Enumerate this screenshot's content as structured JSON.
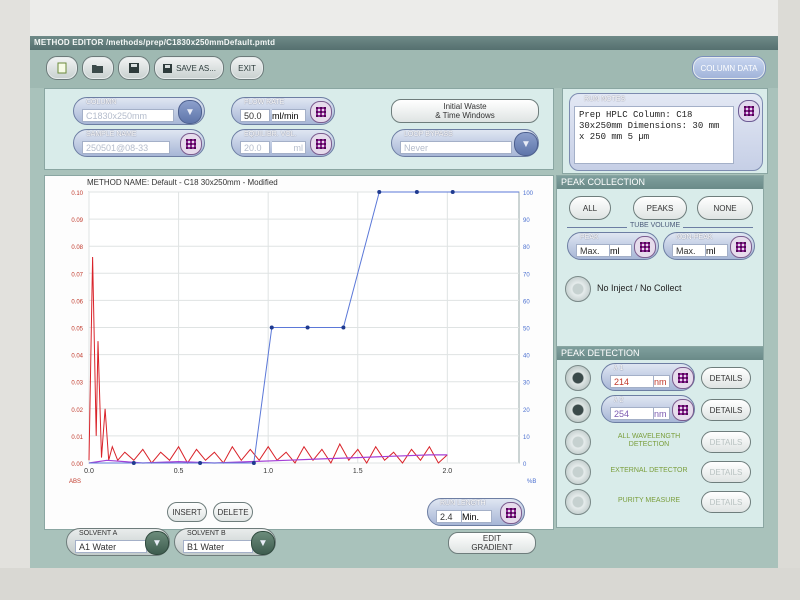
{
  "window": {
    "title": "METHOD EDITOR /methods/prep/C1830x250mmDefault.pmtd"
  },
  "toolbar": {
    "new_icon": "new-file-icon",
    "open_icon": "open-folder-icon",
    "save_icon": "save-disk-icon",
    "save_as_label": "SAVE AS...",
    "exit_label": "EXIT",
    "column_data_label": "COLUMN DATA"
  },
  "method": {
    "column": {
      "label": "COLUMN",
      "value": "C1830x250mm"
    },
    "sample_name": {
      "label": "SAMPLE NAME",
      "value": "250501@08-33"
    },
    "flow_rate": {
      "label": "FLOW RATE",
      "value": "50.0",
      "unit": "ml/min"
    },
    "equilibr_vol": {
      "label": "EQUILIBR. VOL.",
      "value": "20.0",
      "unit": "ml"
    },
    "initial_waste_label": "Initial Waste\n& Time Windows",
    "loop_bypass": {
      "label": "LOOP BYPASS",
      "value": "Never"
    }
  },
  "run_notes": {
    "label": "RUN NOTES",
    "text": "Prep HPLC Column: C18\n30x250mm Dimensions: 30 mm\nx 250 mm 5 µm"
  },
  "chart_title": "METHOD NAME: Default - C18 30x250mm - Modified",
  "chart_data": {
    "type": "line",
    "xlabel": "",
    "ylabel_left": "ABS",
    "ylabel_right": "%B",
    "xlim": [
      0,
      2.4
    ],
    "ylim_left": [
      0,
      0.1
    ],
    "ylim_right": [
      0,
      100
    ],
    "x_ticks": [
      "0.0",
      "0.5",
      "1.0",
      "1.5",
      "2.0"
    ],
    "y_ticks_left": [
      "0.00",
      "0.01",
      "0.02",
      "0.03",
      "0.04",
      "0.05",
      "0.06",
      "0.07",
      "0.08",
      "0.09",
      "0.10"
    ],
    "y_ticks_right": [
      "0",
      "10",
      "20",
      "30",
      "40",
      "50",
      "60",
      "70",
      "80",
      "90",
      "100"
    ],
    "gradient": {
      "x": [
        0.0,
        0.25,
        0.62,
        0.92,
        1.02,
        1.22,
        1.42,
        1.62,
        1.83,
        2.03,
        2.4
      ],
      "y": [
        0,
        0,
        0,
        0,
        50,
        50,
        50,
        100,
        100,
        100,
        100
      ]
    },
    "absorbance_red": {
      "x": [
        0.0,
        0.02,
        0.04,
        0.05,
        0.07,
        0.09,
        0.11,
        0.13,
        0.16,
        0.2,
        0.25,
        0.3,
        0.35,
        0.4,
        0.45,
        0.5,
        0.55,
        0.6,
        0.65,
        0.7,
        0.75,
        0.8,
        0.85,
        0.9,
        0.95,
        1.0,
        1.05,
        1.1,
        1.15,
        1.2,
        1.25,
        1.3,
        1.35,
        1.4,
        1.45,
        1.5,
        1.55,
        1.6,
        1.65,
        1.7,
        1.75,
        1.8,
        1.85,
        1.9,
        1.95,
        2.0
      ],
      "y": [
        0.001,
        0.076,
        0.01,
        0.045,
        0.002,
        0.02,
        0.001,
        0.006,
        0.001,
        0.004,
        0.001,
        0.005,
        0.0,
        0.004,
        0.001,
        0.006,
        0.0,
        0.005,
        0.001,
        0.004,
        0.0,
        0.006,
        0.001,
        0.005,
        0.001,
        0.006,
        0.001,
        0.004,
        0.0,
        0.006,
        0.001,
        0.005,
        0.0,
        0.007,
        0.001,
        0.005,
        0.0,
        0.006,
        0.001,
        0.004,
        0.0,
        0.005,
        0.001,
        0.006,
        0.0,
        0.003
      ]
    },
    "absorbance_purple": {
      "x": [
        0.0,
        0.1,
        0.3,
        0.5,
        0.7,
        0.9,
        1.1,
        1.3,
        1.5,
        1.7,
        1.9,
        2.0
      ],
      "y": [
        0.0,
        0.001,
        0.0,
        0.0005,
        0.0,
        0.0005,
        0.001,
        0.0015,
        0.002,
        0.0025,
        0.003,
        0.003
      ]
    }
  },
  "chart_buttons": {
    "insert": "INSERT",
    "delete": "DELETE",
    "edit_gradient": "EDIT\nGRADIENT"
  },
  "run_length": {
    "label": "RUN LENGTH",
    "value": "2.4",
    "unit": "Min."
  },
  "solvent_a": {
    "label": "SOLVENT A",
    "value": "A1 Water"
  },
  "solvent_b": {
    "label": "SOLVENT B",
    "value": "B1 Water"
  },
  "peak_collection": {
    "title": "PEAK COLLECTION",
    "modes": [
      "ALL",
      "PEAKS",
      "NONE"
    ],
    "tube_volume_label": "TUBE VOLUME",
    "peak": {
      "label": "PEAK",
      "value": "Max.",
      "unit": "ml"
    },
    "non_peak": {
      "label": "NON-PEAK",
      "value": "Max.",
      "unit": "ml"
    },
    "no_inject_label": "No Inject / No Collect"
  },
  "peak_detection": {
    "title": "PEAK DETECTION",
    "lambda1": {
      "label": "λ 1",
      "value": "214",
      "unit": "nm"
    },
    "lambda2": {
      "label": "λ 2",
      "value": "254",
      "unit": "nm"
    },
    "details_label": "DETAILS",
    "all_wavelength_label": "ALL WAVELENGTH\nDETECTION",
    "external_detector_label": "EXTERNAL DETECTOR",
    "purity_measure_label": "PURITY MEASURE"
  },
  "colors": {
    "gradient_line": "#5b78d8",
    "absorbance_red": "#d9232a",
    "absorbance_purple": "#a440d6",
    "panel_bg": "#d9ecea"
  }
}
